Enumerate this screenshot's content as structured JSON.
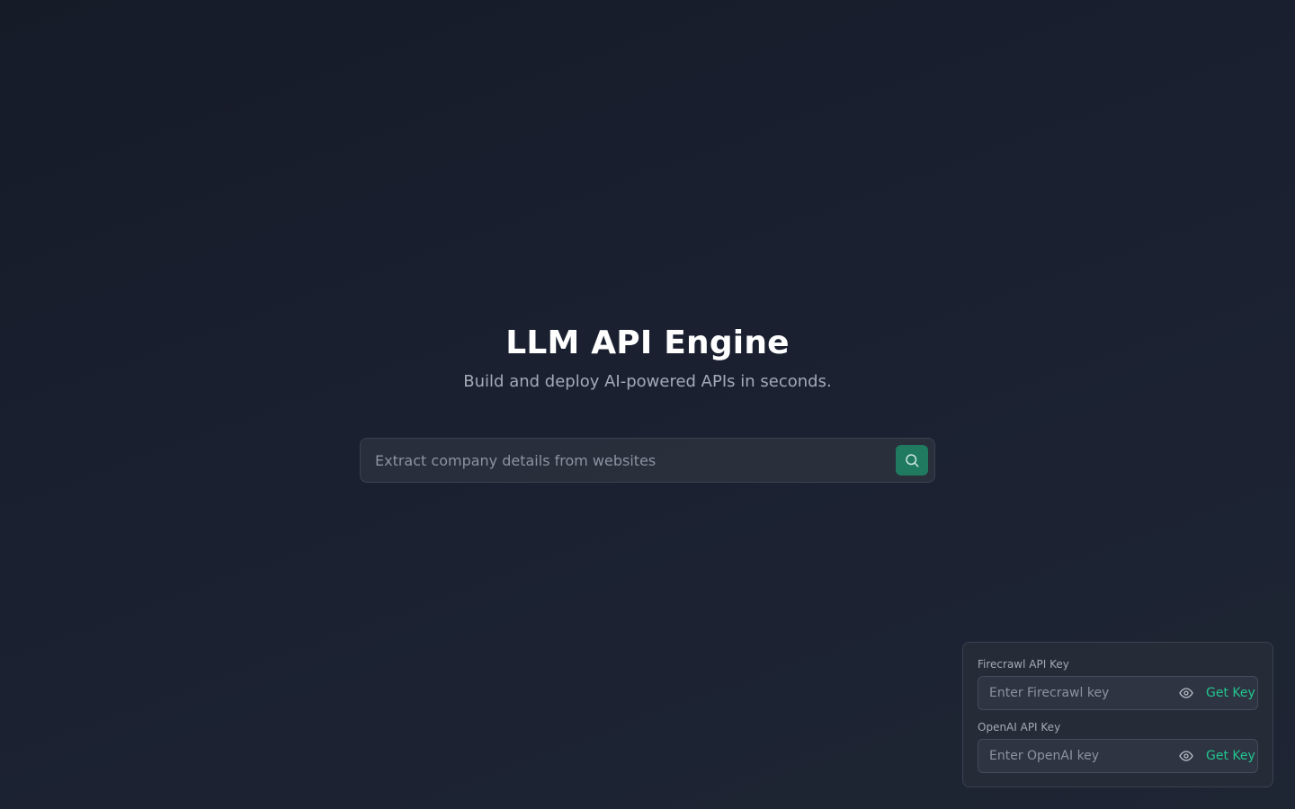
{
  "hero": {
    "title": "LLM API Engine",
    "subtitle": "Build and deploy AI-powered APIs in seconds."
  },
  "search": {
    "placeholder": "Extract company details from websites",
    "value": "",
    "button_icon": "search-icon"
  },
  "api_keys": {
    "firecrawl": {
      "label": "Firecrawl API Key",
      "placeholder": "Enter Firecrawl key",
      "value": "",
      "toggle_icon": "eye-icon",
      "link_label": "Get Key"
    },
    "openai": {
      "label": "OpenAI API Key",
      "placeholder": "Enter OpenAI key",
      "value": "",
      "toggle_icon": "eye-icon",
      "link_label": "Get Key"
    }
  },
  "colors": {
    "background": "#181d2a",
    "accent": "#1f7a60",
    "link": "#22c58f",
    "muted_text": "#a3aab6"
  }
}
